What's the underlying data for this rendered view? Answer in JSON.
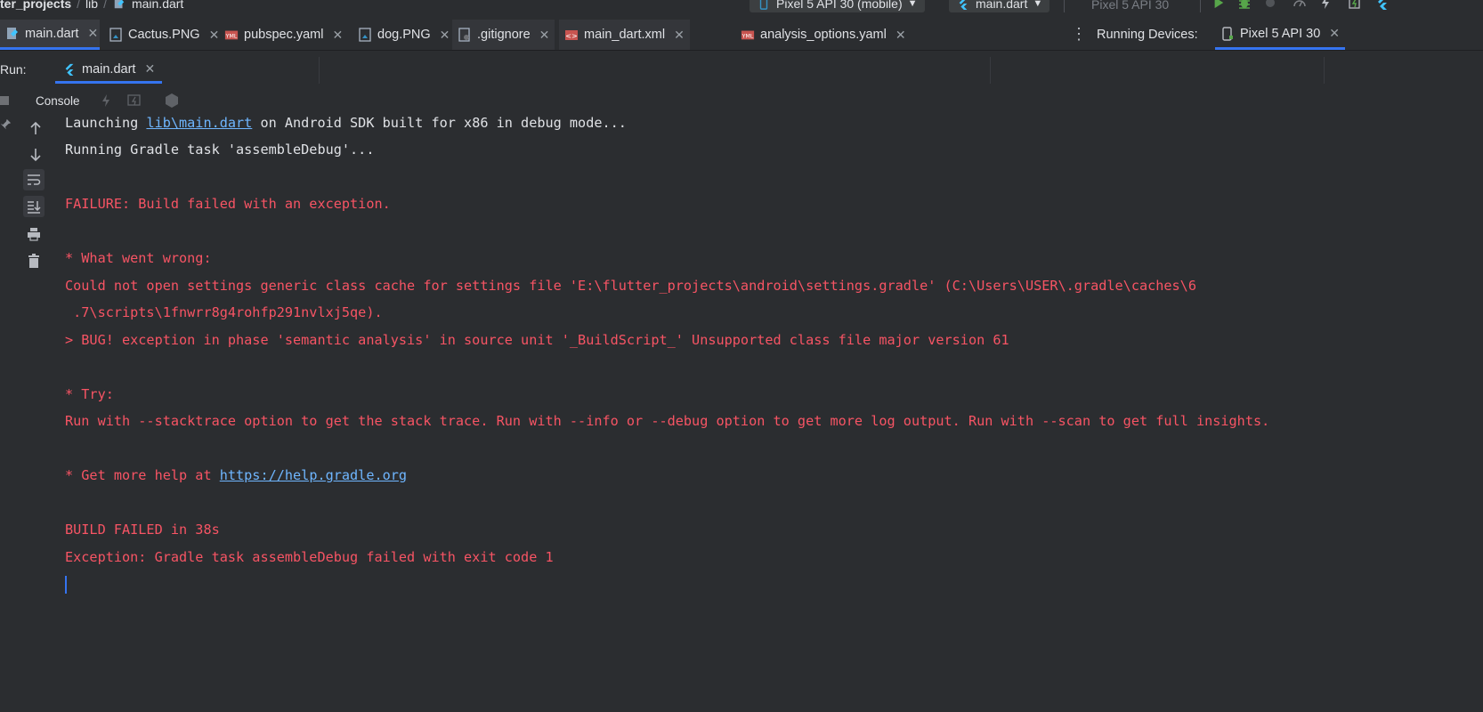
{
  "breadcrumb": {
    "project": "ter_projects",
    "folder": "lib",
    "file": "main.dart"
  },
  "toolbar": {
    "device_selector": "Pixel 5 API 30 (mobile)",
    "run_config": "main.dart",
    "device_dim": "Pixel 5 API 30"
  },
  "tabs": [
    {
      "label": "main.dart",
      "icon": "dart-file-icon"
    },
    {
      "label": "Cactus.PNG",
      "icon": "image-file-icon"
    },
    {
      "label": "pubspec.yaml",
      "icon": "yaml-file-icon"
    },
    {
      "label": "dog.PNG",
      "icon": "image-file-icon"
    },
    {
      "label": ".gitignore",
      "icon": "gitignore-file-icon"
    },
    {
      "label": "main_dart.xml",
      "icon": "xml-file-icon"
    },
    {
      "label": "analysis_options.yaml",
      "icon": "yaml-file-icon"
    }
  ],
  "running_devices": {
    "label": "Running Devices:",
    "device_tab": "Pixel 5 API 30"
  },
  "run_panel": {
    "label": "Run:",
    "tab": "main.dart",
    "console_label": "Console"
  },
  "console": {
    "launch_prefix": "Launching ",
    "launch_link": "lib\\main.dart",
    "launch_suffix": " on Android SDK built for x86 in debug mode...",
    "gradle_task": "Running Gradle task 'assembleDebug'...",
    "failure": "FAILURE: Build failed with an exception.",
    "what_went_wrong": "* What went wrong:",
    "could_not_open_1": "Could not open settings generic class cache for settings file 'E:\\flutter_projects\\android\\settings.gradle' (C:\\Users\\USER\\.gradle\\caches\\6",
    "could_not_open_2": " .7\\scripts\\1fnwrr8g4rohfp291nvlxj5qe).",
    "bug_line": "> BUG! exception in phase 'semantic analysis' in source unit '_BuildScript_' Unsupported class file major version 61",
    "try": "* Try:",
    "run_with": "Run with --stacktrace option to get the stack trace. Run with --info or --debug option to get more log output. Run with --scan to get full insights.",
    "help_prefix": "* Get more help at ",
    "help_link": "https://help.gradle.org",
    "build_failed": "BUILD FAILED in 38s",
    "exception": "Exception: Gradle task assembleDebug failed with exit code 1"
  },
  "colors": {
    "background": "#2b2d30",
    "error_text": "#f75464",
    "link": "#6fb6ff",
    "accent": "#3574f0"
  }
}
